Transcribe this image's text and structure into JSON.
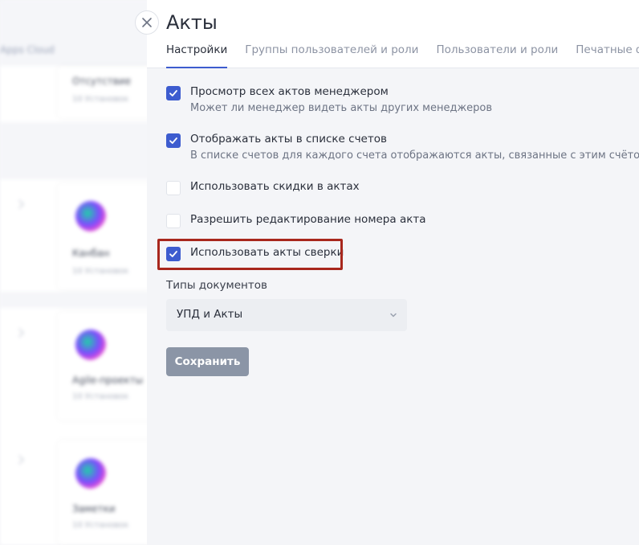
{
  "background_app": {
    "header_text": "Apps Cloud",
    "cards": [
      {
        "title": "Отсутствие",
        "subtitle": "10 Установок"
      },
      {
        "title": "Канбан",
        "subtitle": "10 Установок"
      },
      {
        "title": "Agile-проекты",
        "subtitle": "10 Установок"
      },
      {
        "title": "Заметки",
        "subtitle": "10 Установок"
      }
    ]
  },
  "panel": {
    "title": "Акты",
    "close_icon": "close-icon",
    "tabs": [
      {
        "label": "Настройки",
        "active": true
      },
      {
        "label": "Группы пользователей и роли",
        "active": false
      },
      {
        "label": "Пользователи и роли",
        "active": false
      },
      {
        "label": "Печатные формы",
        "active": false
      }
    ],
    "options": [
      {
        "label": "Просмотр всех актов менеджером",
        "description": "Может ли менеджер видеть акты других менеджеров",
        "checked": true
      },
      {
        "label": "Отображать акты в списке счетов",
        "description": "В списке счетов для каждого счета отображаются акты, связанные с этим счётом",
        "checked": true
      },
      {
        "label": "Использовать скидки в актах",
        "description": "",
        "checked": false
      },
      {
        "label": "Разрешить редактирование номера акта",
        "description": "",
        "checked": false
      },
      {
        "label": "Использовать акты сверки",
        "description": "",
        "checked": true
      }
    ],
    "doc_types": {
      "label": "Типы документов",
      "value": "УПД и Акты"
    },
    "save_label": "Сохранить"
  },
  "colors": {
    "accent": "#3d5ccf",
    "highlight": "#a8271d",
    "save_button": "#8b95a6"
  }
}
